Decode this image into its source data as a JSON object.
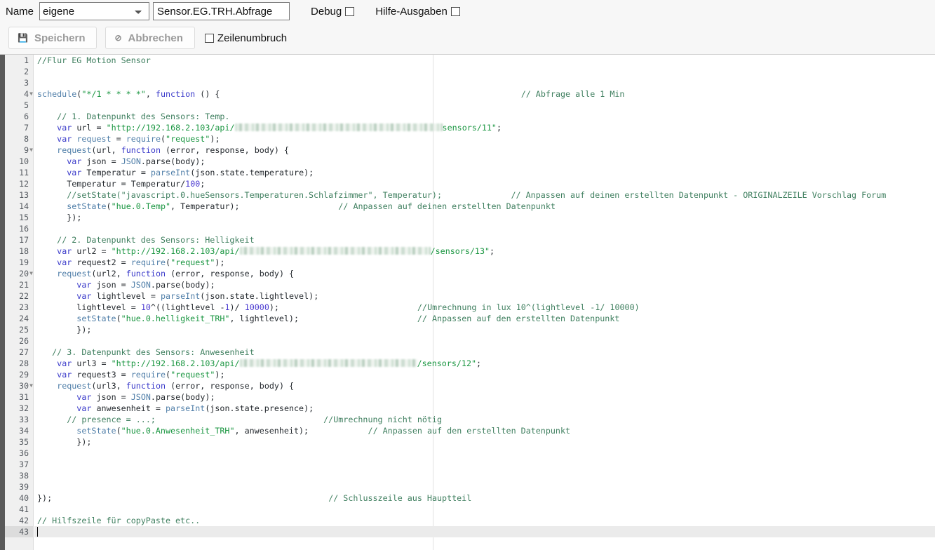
{
  "toolbar": {
    "name_label": "Name",
    "name_select": {
      "value": "eigene",
      "options": [
        "eigene"
      ]
    },
    "script_name": {
      "value": "Sensor.EG.TRH.Abfrage",
      "placeholder": ""
    },
    "debug": {
      "label": "Debug",
      "checked": false
    },
    "help_output": {
      "label": "Hilfe-Ausgaben",
      "checked": false
    },
    "save_button": {
      "label": "Speichern",
      "icon": "save-floppy-icon",
      "disabled": true
    },
    "cancel_button": {
      "label": "Abbrechen",
      "icon": "ban-circle-icon",
      "disabled": true
    },
    "wordwrap": {
      "label": "Zeilenumbruch",
      "checked": false
    }
  },
  "editor": {
    "active_line": 43,
    "total_lines": 43,
    "fold_lines": [
      4,
      9,
      20,
      30
    ],
    "lines": [
      {
        "n": 1,
        "text": "//Flur EG Motion Sensor"
      },
      {
        "n": 2,
        "text": ""
      },
      {
        "n": 3,
        "text": ""
      },
      {
        "n": 4,
        "text": "schedule(\"*/1 * * * *\", function () {                                                             // Abfrage alle 1 Min"
      },
      {
        "n": 5,
        "text": ""
      },
      {
        "n": 6,
        "text": "    // 1. Datenpunkt des Sensors: Temp."
      },
      {
        "n": 7,
        "text": "    var url = \"http://192.168.2.103/api/[REDACTED]sensors/11\";"
      },
      {
        "n": 8,
        "text": "    var request = require(\"request\");"
      },
      {
        "n": 9,
        "text": "    request(url, function (error, response, body) {"
      },
      {
        "n": 10,
        "text": "      var json = JSON.parse(body);"
      },
      {
        "n": 11,
        "text": "      var Temperatur = parseInt(json.state.temperature);"
      },
      {
        "n": 12,
        "text": "      Temperatur = Temperatur/100;"
      },
      {
        "n": 13,
        "text": "      //setState(\"javascript.0.hueSensors.Temperaturen.Schlafzimmer\", Temperatur);              // Anpassen auf deinen erstellten Datenpunkt - ORIGINALZEILE Vorschlag Forum"
      },
      {
        "n": 14,
        "text": "      setState(\"hue.0.Temp\", Temperatur);                    // Anpassen auf deinen erstellten Datenpunkt"
      },
      {
        "n": 15,
        "text": "      });"
      },
      {
        "n": 16,
        "text": ""
      },
      {
        "n": 17,
        "text": "    // 2. Datenpunkt des Sensors: Helligkeit"
      },
      {
        "n": 18,
        "text": "    var url2 = \"http://192.168.2.103/api/[REDACTED]/sensors/13\";"
      },
      {
        "n": 19,
        "text": "    var request2 = require(\"request\");"
      },
      {
        "n": 20,
        "text": "    request(url2, function (error, response, body) {"
      },
      {
        "n": 21,
        "text": "        var json = JSON.parse(body);"
      },
      {
        "n": 22,
        "text": "        var lightlevel = parseInt(json.state.lightlevel);"
      },
      {
        "n": 23,
        "text": "        lightlevel = 10^((lightlevel -1)/ 10000);                            //Umrechnung in lux 10^(lightlevel -1/ 10000)"
      },
      {
        "n": 24,
        "text": "        setState(\"hue.0.helligkeit_TRH\", lightlevel);                        // Anpassen auf den erstellten Datenpunkt"
      },
      {
        "n": 25,
        "text": "        });"
      },
      {
        "n": 26,
        "text": ""
      },
      {
        "n": 27,
        "text": "   // 3. Datenpunkt des Sensors: Anwesenheit"
      },
      {
        "n": 28,
        "text": "    var url3 = \"http://192.168.2.103/api/[REDACTED]/sensors/12\";"
      },
      {
        "n": 29,
        "text": "    var request3 = require(\"request\");"
      },
      {
        "n": 30,
        "text": "    request(url3, function (error, response, body) {"
      },
      {
        "n": 31,
        "text": "        var json = JSON.parse(body);"
      },
      {
        "n": 32,
        "text": "        var anwesenheit = parseInt(json.state.presence);"
      },
      {
        "n": 33,
        "text": "      // presence = ...;                                  //Umrechnung nicht nötig"
      },
      {
        "n": 34,
        "text": "        setState(\"hue.0.Anwesenheit_TRH\", anwesenheit);            // Anpassen auf den erstellten Datenpunkt"
      },
      {
        "n": 35,
        "text": "        });"
      },
      {
        "n": 36,
        "text": ""
      },
      {
        "n": 37,
        "text": ""
      },
      {
        "n": 38,
        "text": ""
      },
      {
        "n": 39,
        "text": ""
      },
      {
        "n": 40,
        "text": "});                                                        // Schlusszeile aus Hauptteil"
      },
      {
        "n": 41,
        "text": ""
      },
      {
        "n": 42,
        "text": "// Hilfszeile für copyPaste etc.."
      },
      {
        "n": 43,
        "text": ""
      }
    ]
  },
  "colors": {
    "comment": "#3f7f5f",
    "keyword": "#3a3aca",
    "string": "#1a9641",
    "builtin": "#4f7ea8",
    "number": "#4a3ad0",
    "gutter_bg": "#f0f0f0",
    "toolbar_bg": "#f7f7f7",
    "active_line_bg": "#ebebeb"
  }
}
